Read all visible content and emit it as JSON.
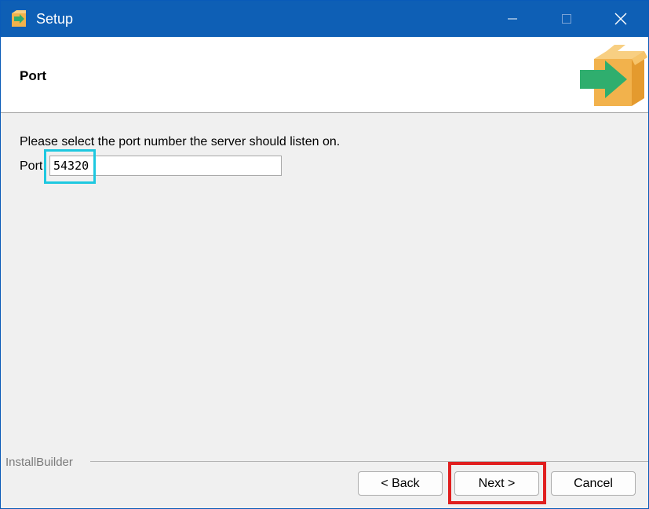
{
  "window": {
    "title": "Setup",
    "controls": {
      "minimize": "minimize",
      "maximize": "maximize",
      "close": "close"
    }
  },
  "header": {
    "title": "Port"
  },
  "main": {
    "prompt": "Please select the port number the server should listen on.",
    "port_label": "Port",
    "port_value": "54320"
  },
  "footer": {
    "brand": "InstallBuilder",
    "back_label": "< Back",
    "next_label": "Next >",
    "cancel_label": "Cancel"
  },
  "colors": {
    "titlebar": "#0e5fb5",
    "highlight_port": "#1ec8e0",
    "highlight_next": "#e01f1f",
    "box": "#f2b24c",
    "arrow": "#2fae6e"
  }
}
